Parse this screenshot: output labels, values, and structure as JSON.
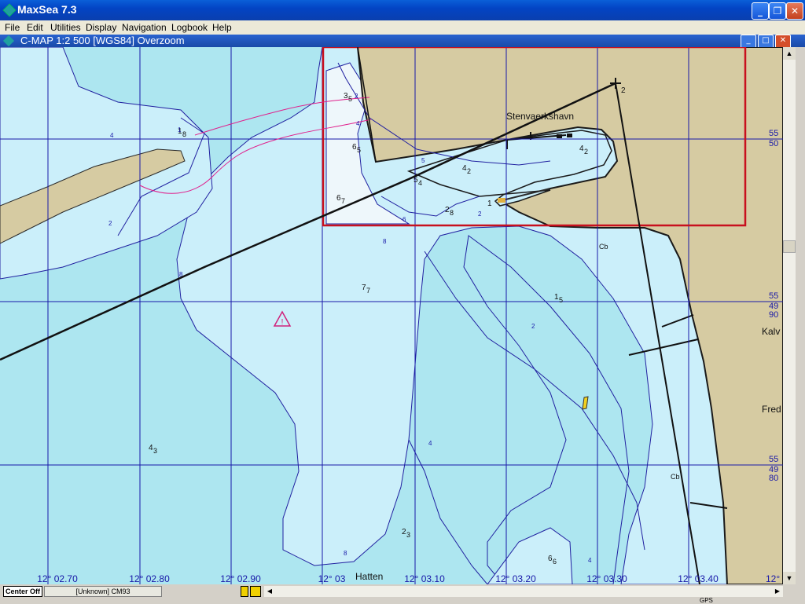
{
  "window": {
    "app_title": "MaxSea 7.3",
    "minimize": "_",
    "maximize": "❐",
    "close": "✕"
  },
  "menu": [
    "File",
    "Edit",
    "Utilities",
    "Display",
    "Navigation",
    "Logbook",
    "Help"
  ],
  "chart_window": {
    "title": "C-MAP  1:2 500 [WGS84]    Overzoom"
  },
  "chart": {
    "place_names": {
      "harbor": "Stenvaerkshavn",
      "hatten": "Hatten",
      "kalv": "Kalv",
      "fred": "Fred"
    },
    "longitude_labels": [
      "12° 02.70",
      "12° 02.80",
      "12° 02.90",
      "12° 03",
      "12° 03.10",
      "12° 03.20",
      "12° 03.30",
      "12° 03.40"
    ],
    "latitude_labels": [
      {
        "deg": "55",
        "min": "50"
      },
      {
        "deg": "55",
        "min": "49",
        "sub": "90"
      },
      {
        "deg": "55",
        "min": "49",
        "sub": "80"
      }
    ],
    "extra_lat_label": "12°",
    "waypoint_label": "2",
    "bottom_labels": [
      "Cb",
      "Cb"
    ],
    "soundings": [
      {
        "main": "1",
        "sub": "8"
      },
      {
        "main": "3",
        "sub": "5"
      },
      {
        "main": "6",
        "sub": "5"
      },
      {
        "main": "5",
        "sub": "4"
      },
      {
        "main": "4",
        "sub": "2"
      },
      {
        "main": "4",
        "sub": "2"
      },
      {
        "main": "6",
        "sub": "7"
      },
      {
        "main": "2",
        "sub": "8"
      },
      {
        "main": "1",
        "sub": ""
      },
      {
        "main": "7",
        "sub": "7"
      },
      {
        "main": "1",
        "sub": "5"
      },
      {
        "main": "4",
        "sub": "3"
      },
      {
        "main": "2",
        "sub": "3"
      },
      {
        "main": "6",
        "sub": "6"
      }
    ],
    "contour_labels": [
      "4",
      "2",
      "8",
      "8",
      "6",
      "2",
      "2",
      "4",
      "4",
      "2",
      "8",
      "4",
      "1",
      "5"
    ]
  },
  "statusbar": {
    "center_button": "Center Off",
    "chart_info": "[Unknown] CM93",
    "gps": "GPS"
  },
  "colors": {
    "deep_water": "#ade6f0",
    "shallow_water": "#cbeffa",
    "very_shallow": "#eef7fb",
    "land": "#d6cba2",
    "grid": "#1818a8",
    "zone_border": "#c8101e",
    "route": "#1a1a1a",
    "track": "#e0208c"
  }
}
